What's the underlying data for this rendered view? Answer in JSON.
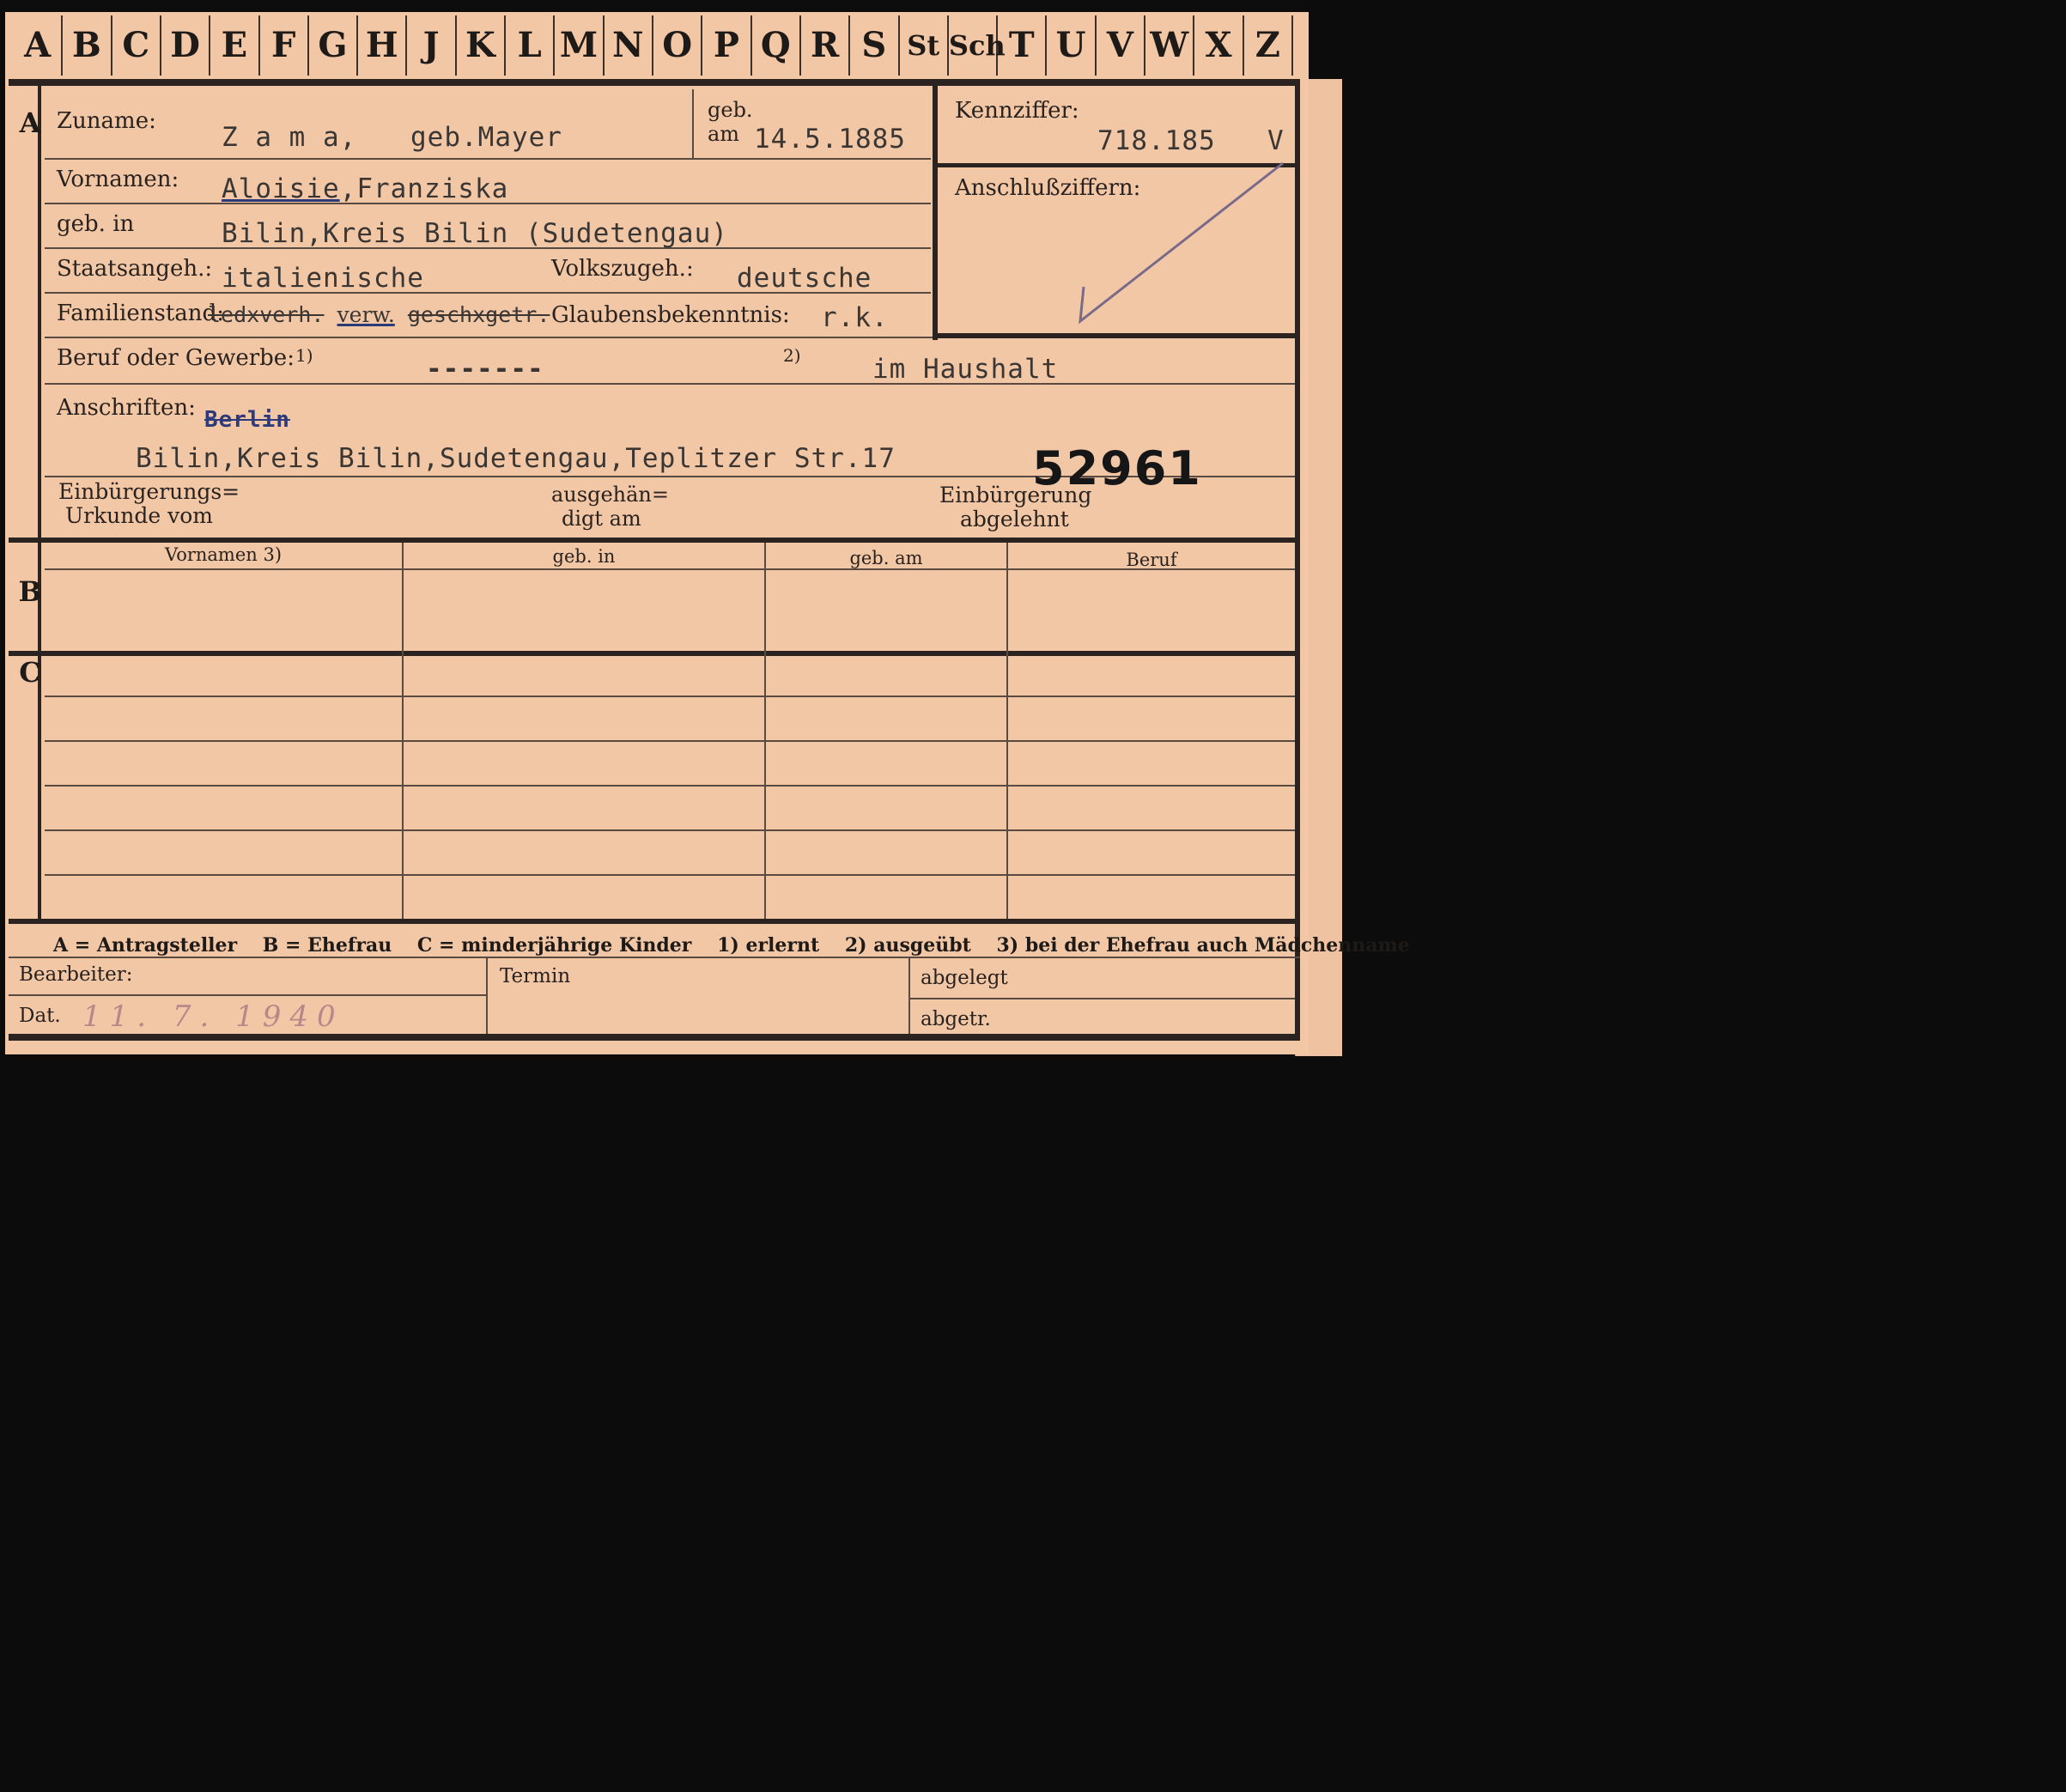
{
  "index_letters": [
    "A",
    "B",
    "C",
    "D",
    "E",
    "F",
    "G",
    "H",
    "J",
    "K",
    "L",
    "M",
    "N",
    "O",
    "P",
    "Q",
    "R",
    "S",
    "St",
    "Sch",
    "T",
    "U",
    "V",
    "W",
    "X",
    "Z"
  ],
  "section_labels": {
    "a": "A",
    "b": "B",
    "c": "C"
  },
  "person": {
    "surname_label": "Zuname:",
    "surname_value": "Z a m a,",
    "maiden_value": "geb.Mayer",
    "born_label_1": "geb.",
    "born_label_2": "am",
    "born_date": "14.5.1885",
    "firstnames_label": "Vornamen:",
    "firstname_1": "Aloisie",
    "firstname_rest": ",Franziska",
    "birthplace_label": "geb. in",
    "birthplace_value": "Bilin,Kreis Bilin (Sudetengau)",
    "citizenship_label": "Staatsangeh.:",
    "citizenship_value": "italienische",
    "ethnicity_label": "Volkszugeh.:",
    "ethnicity_value": "deutsche",
    "marital_label": "Familienstand:",
    "marital_struck_1": "ledxverh.",
    "marital_value": "verw.",
    "marital_struck_2": "geschxgetr.",
    "religion_label": "Glaubensbekenntnis:",
    "religion_value": "r.k.",
    "occupation_label": "Beruf oder Gewerbe:",
    "occupation_note_1": "1)",
    "occupation_value_1": "-------",
    "occupation_note_2": "2)",
    "occupation_value_2": "im Haushalt",
    "address_label": "Anschriften:",
    "address_struck": "Berlin",
    "address_value": "Bilin,Kreis Bilin,Sudetengau,Teplitzer Str.17",
    "stamp_number": "52961",
    "naturalization_label_1": "Einbürgerungs=",
    "naturalization_label_2": "Urkunde vom",
    "handed_label_1": "ausgehän=",
    "handed_label_2": "digt am",
    "refused_label_1": "Einbürgerung",
    "refused_label_2": "abgelehnt"
  },
  "reference": {
    "code_label": "Kennziffer:",
    "code_value": "718.185",
    "code_suffix": "V",
    "linked_label": "Anschlußziffern:"
  },
  "table": {
    "headers": [
      "Vornamen 3)",
      "geb. in",
      "geb. am",
      "Beruf"
    ]
  },
  "legend": {
    "items": [
      "A = Antragsteller",
      "B = Ehefrau",
      "C = minderjährige Kinder",
      "1) erlernt",
      "2) ausgeübt",
      "3) bei der Ehefrau auch Mädchenname"
    ]
  },
  "footer": {
    "clerk_label": "Bearbeiter:",
    "date_label": "Dat.",
    "date_value": "11. 7. 1940",
    "deadline_label": "Termin",
    "filed_label": "abgelegt",
    "removed_label": "abgetr."
  }
}
